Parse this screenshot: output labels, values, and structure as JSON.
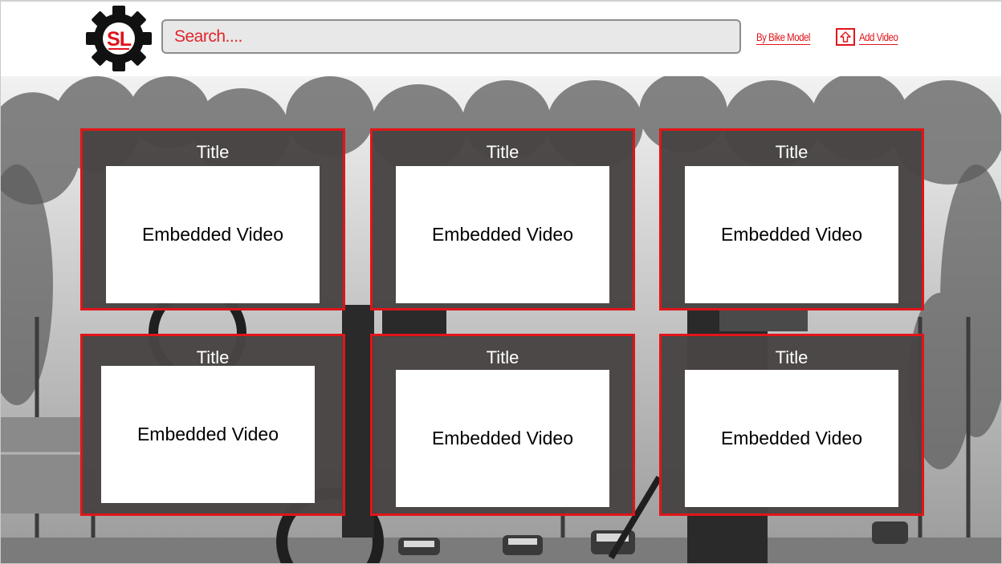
{
  "header": {
    "logo_text": "SL",
    "search": {
      "placeholder": "Search....",
      "value": ""
    },
    "nav": {
      "by_bike_model": "By Bike Model",
      "add_video": "Add Video"
    }
  },
  "icons": {
    "logo": "gear-icon",
    "add_video": "upload-arrow-icon"
  },
  "colors": {
    "accent": "#e0141b",
    "card_bg": "#484443",
    "search_bg": "#e8e8e8"
  },
  "videos": [
    {
      "title": "Title",
      "placeholder": "Embedded Video"
    },
    {
      "title": "Title",
      "placeholder": "Embedded Video"
    },
    {
      "title": "Title",
      "placeholder": "Embedded Video"
    },
    {
      "title": "Title",
      "placeholder": "Embedded Video"
    },
    {
      "title": "Title",
      "placeholder": "Embedded Video"
    },
    {
      "title": "Title",
      "placeholder": "Embedded Video"
    }
  ]
}
